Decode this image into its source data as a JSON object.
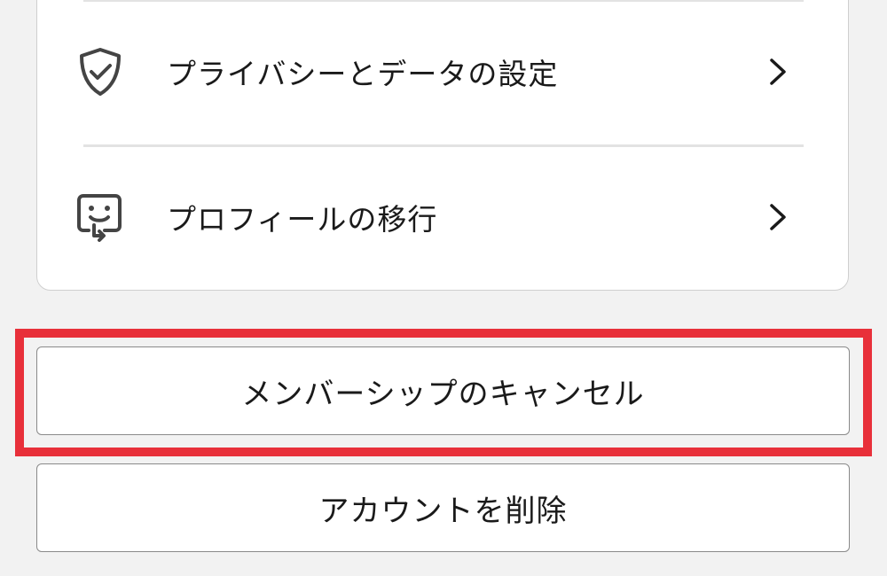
{
  "settings_card": {
    "rows": [
      {
        "label": "プライバシーとデータの設定",
        "icon": "shield-check-icon"
      },
      {
        "label": "プロフィールの移行",
        "icon": "profile-transfer-icon"
      }
    ]
  },
  "buttons": {
    "cancel_membership": "メンバーシップのキャンセル",
    "delete_account": "アカウントを削除"
  },
  "colors": {
    "highlight": "#e8303a",
    "icon": "#444444",
    "text": "#1a1a1a"
  }
}
